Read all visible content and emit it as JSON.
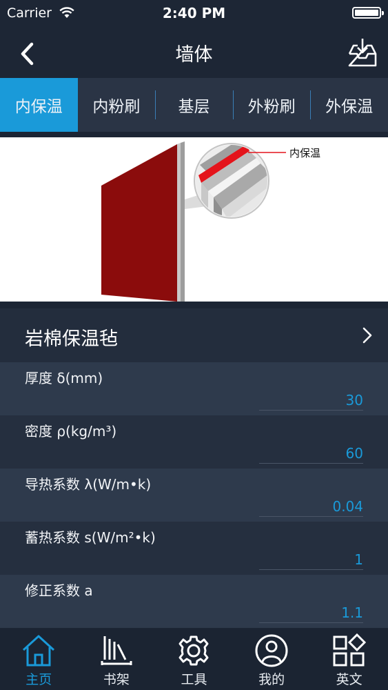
{
  "status_bar": {
    "carrier": "Carrier",
    "time": "2:40 PM"
  },
  "nav": {
    "title": "墙体",
    "back_icon": "chevron-left-icon",
    "download_icon": "tray-download-icon"
  },
  "tabs": [
    {
      "label": "内保温",
      "active": true
    },
    {
      "label": "内粉刷",
      "active": false
    },
    {
      "label": "基层",
      "active": false
    },
    {
      "label": "外粉刷",
      "active": false
    },
    {
      "label": "外保温",
      "active": false
    }
  ],
  "illustration": {
    "callout": "内保温"
  },
  "material": {
    "name": "岩棉保温毡"
  },
  "fields": [
    {
      "label": "厚度 δ(mm)",
      "value": "30"
    },
    {
      "label": "密度 ρ(kg/m³)",
      "value": "60"
    },
    {
      "label": "导热系数 λ(W/m•k)",
      "value": "0.04"
    },
    {
      "label": "蓄热系数 s(W/m²•k)",
      "value": "1"
    },
    {
      "label": "修正系数 a",
      "value": "1.1"
    }
  ],
  "tabbar": [
    {
      "label": "主页",
      "icon": "home-icon",
      "active": true
    },
    {
      "label": "书架",
      "icon": "bookshelf-icon",
      "active": false
    },
    {
      "label": "工具",
      "icon": "gear-icon",
      "active": false
    },
    {
      "label": "我的",
      "icon": "user-icon",
      "active": false
    },
    {
      "label": "英文",
      "icon": "apps-icon",
      "active": false
    }
  ],
  "colors": {
    "accent": "#1a9ad9",
    "background": "#1c2534",
    "wall_red": "#8b0c0c",
    "insulation_red": "#e4141b"
  }
}
